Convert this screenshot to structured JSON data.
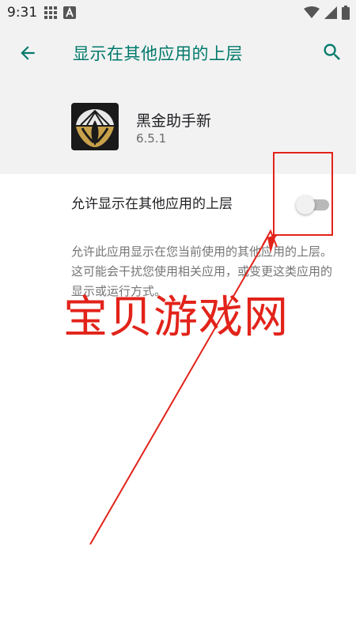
{
  "status_bar": {
    "time": "9:31",
    "left_icons": [
      "grid-icon",
      "a-badge-icon"
    ],
    "right_icons": [
      "wifi-icon",
      "signal-icon",
      "battery-icon"
    ]
  },
  "app_bar": {
    "title": "显示在其他应用的上层",
    "back_icon": "back-arrow-icon",
    "search_icon": "search-icon"
  },
  "app_info": {
    "name": "黑金助手新",
    "version": "6.5.1"
  },
  "setting": {
    "label": "允许显示在其他应用的上层",
    "enabled": false
  },
  "description": "允许此应用显示在您当前使用的其他应用的上层。这可能会干扰您使用相关应用，或变更这类应用的显示或运行方式。",
  "annotation": {
    "watermark_text": "宝贝游戏网",
    "color": "#e2231a"
  },
  "colors": {
    "accent": "#00796b",
    "header_bg": "#f2f2f2",
    "annotation": "#e2231a"
  }
}
